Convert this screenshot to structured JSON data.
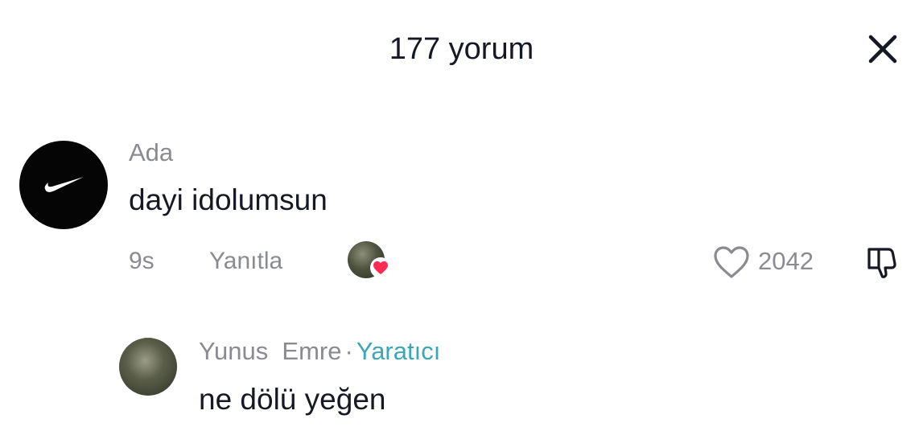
{
  "header": {
    "title": "177 yorum",
    "close_icon": "close-icon"
  },
  "comment": {
    "author": "Ada",
    "text": "dayi idolumsun",
    "time": "9s",
    "reply_label": "Yanıtla",
    "like_count": "2042",
    "avatar_icon": "nike-swoosh-icon"
  },
  "reply": {
    "author": "Yunus  Emre",
    "separator": "·",
    "creator_label": "Yaratıcı",
    "text": "ne dölü yeğen",
    "creator_color": "#3aa6b9"
  },
  "colors": {
    "heart_red": "#fe2c55",
    "muted_text": "#8a8b91"
  }
}
